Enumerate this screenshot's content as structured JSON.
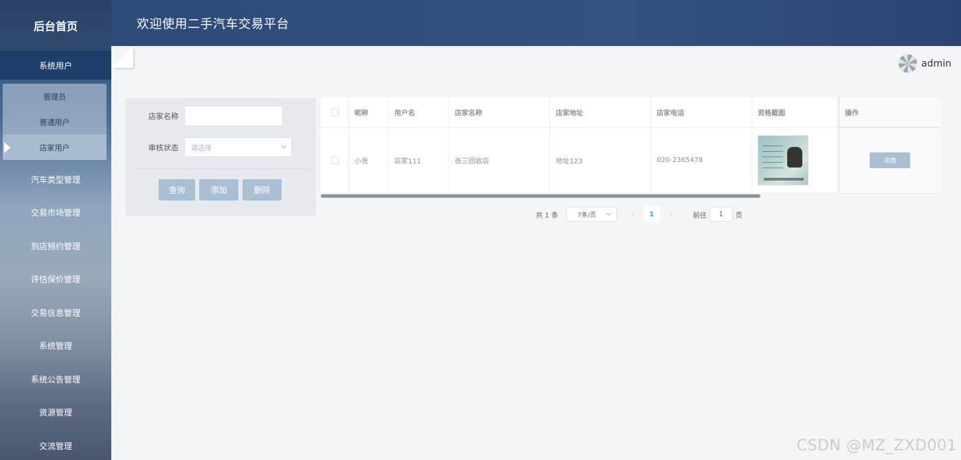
{
  "sidebar": {
    "brand": "后台首页",
    "system_users": "系统用户",
    "sub_items": [
      "管理员",
      "普通用户",
      "店家用户"
    ],
    "items": [
      "汽车类型管理",
      "交易市场管理",
      "到店预约管理",
      "评估保价管理",
      "交易信息管理",
      "系统管理",
      "系统公告管理",
      "资源管理",
      "交流管理"
    ]
  },
  "header": {
    "title": "欢迎使用二手汽车交易平台"
  },
  "user": {
    "name": "admin",
    "avatar_icon": "user-avatar-icon"
  },
  "search": {
    "shop_name_label": "店家名称",
    "shop_name_value": "",
    "audit_label": "审核状态",
    "audit_placeholder": "请选择",
    "query": "查询",
    "add": "添加",
    "delete": "删除"
  },
  "table": {
    "headers": [
      "昵称",
      "用户名",
      "店家名称",
      "店家地址",
      "店家电话",
      "资格截图",
      "操作"
    ],
    "rows": [
      {
        "nickname": "小张",
        "username": "店家111",
        "shop_name": "张三回收店",
        "address": "地址123",
        "phone": "020-2365478",
        "action": "详情"
      }
    ]
  },
  "pagination": {
    "total": "共 1 条",
    "page_size": "7条/页",
    "current": "1",
    "goto_label": "前往",
    "goto_value": "1",
    "page_suffix": "页"
  },
  "watermark": "CSDN @MZ_ZXD001",
  "colors": {
    "sidebar_active": "#1f3f6a",
    "header": "#2d4b79",
    "button": "#a9bfd3",
    "page_active": "#409eff"
  }
}
